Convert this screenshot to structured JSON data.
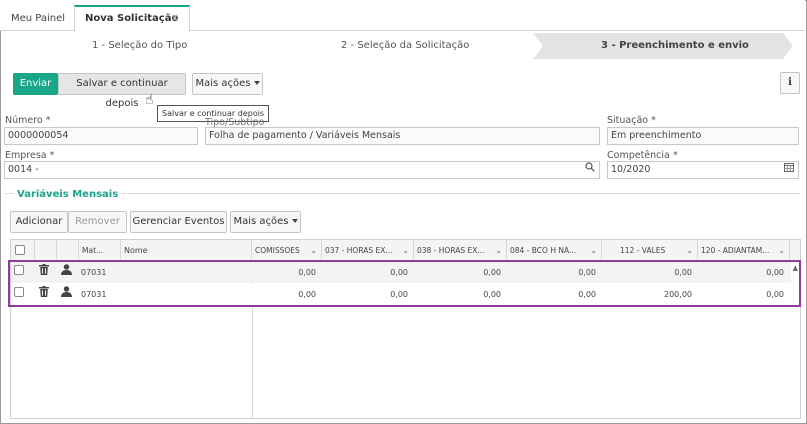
{
  "tabs": [
    {
      "label": "Meu Painel",
      "active": false
    },
    {
      "label": "Nova Solicitação",
      "active": true
    }
  ],
  "tab_close": "✕",
  "steps": [
    {
      "label": "1 - Seleção do Tipo",
      "active": false
    },
    {
      "label": "2 - Seleção da Solicitação",
      "active": false
    },
    {
      "label": "3 - Preenchimento e envio",
      "active": true
    }
  ],
  "toolbar": {
    "send_label": "Enviar",
    "save_continue_label": "Salvar e continuar depois",
    "more_actions_label": "Mais ações",
    "info_label": "i",
    "tooltip": "Salvar e continuar depois"
  },
  "form": {
    "numero": {
      "label": "Número *",
      "value": "0000000054"
    },
    "tipo_subtipo": {
      "label": "Tipo/Subtipo",
      "value": "Folha de pagamento / Variáveis Mensais"
    },
    "situacao": {
      "label": "Situação *",
      "value": "Em preenchimento"
    },
    "empresa": {
      "label": "Empresa *",
      "value": "0014 -"
    },
    "competencia": {
      "label": "Competência *",
      "value": "10/2020"
    }
  },
  "section": {
    "title": "Variáveis Mensais",
    "add_label": "Adicionar",
    "remove_label": "Remover",
    "manage_label": "Gerenciar Eventos",
    "more_actions_label": "Mais ações"
  },
  "grid": {
    "columns": [
      "Mat...",
      "Nome",
      "COMISSOES",
      "037 - HORAS EX...",
      "038 - HORAS EX...",
      "084 - BCO H NA...",
      "112 - VALES",
      "120 - ADIANTAM..."
    ],
    "rows": [
      {
        "mat": "07031",
        "nome": "",
        "values": [
          "0,00",
          "0,00",
          "0,00",
          "0,00",
          "0,00",
          "0,00"
        ]
      },
      {
        "mat": "07031",
        "nome": "",
        "values": [
          "0,00",
          "0,00",
          "0,00",
          "0,00",
          "200,00",
          "0,00"
        ]
      }
    ]
  },
  "colors": {
    "accent": "#18a689",
    "highlight": "#8e3d9a"
  }
}
